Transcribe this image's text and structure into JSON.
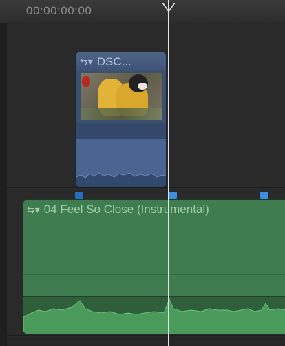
{
  "ruler": {
    "timecode": "00:00:00:00"
  },
  "video_clip": {
    "title": "DSC...",
    "icon": "clip-options-icon"
  },
  "audio_clip": {
    "title": "04 Feel So Close (Instrumental)",
    "icon": "clip-options-icon"
  },
  "colors": {
    "video_clip": "#4a6592",
    "audio_clip": "#3f7d50",
    "marker": "#3f8de0",
    "playhead": "#e4e4e4"
  }
}
